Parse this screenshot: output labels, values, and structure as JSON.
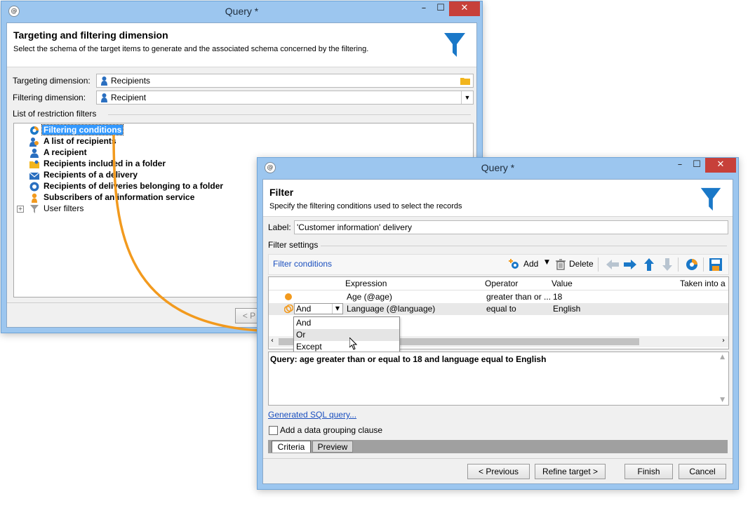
{
  "back_window": {
    "title": "Query *",
    "header_title": "Targeting and filtering dimension",
    "header_subtitle": "Select the schema of the target items to  generate and the associated schema concerned by the filtering.",
    "targeting_label": "Targeting dimension:",
    "targeting_value": "Recipients",
    "filtering_label": "Filtering dimension:",
    "filtering_value": "Recipient",
    "list_label": "List of restriction filters",
    "filters": [
      {
        "label": "Filtering conditions",
        "icon": "filtering-conditions-icon"
      },
      {
        "label": "A list of recipients",
        "icon": "recipient-list-icon"
      },
      {
        "label": "A recipient",
        "icon": "recipient-icon"
      },
      {
        "label": "Recipients included in a folder",
        "icon": "folder-icon"
      },
      {
        "label": "Recipients of a delivery",
        "icon": "envelope-icon"
      },
      {
        "label": "Recipients of deliveries belonging to a folder",
        "icon": "delivery-folder-icon"
      },
      {
        "label": "Subscribers of an information service",
        "icon": "subscriber-icon"
      },
      {
        "label": "User filters",
        "icon": "funnel-icon"
      }
    ],
    "prev_button": "< P"
  },
  "front_window": {
    "title": "Query *",
    "header_title": "Filter",
    "header_subtitle": "Specify the filtering conditions used to select the records",
    "label_label": "Label:",
    "label_value": "'Customer information' delivery",
    "filter_settings": "Filter settings",
    "filter_conditions_link": "Filter conditions",
    "add": "Add",
    "delete": "Delete",
    "columns": {
      "expression": "Expression",
      "operator": "Operator",
      "value": "Value",
      "taken": "Taken into a"
    },
    "rows": [
      {
        "expression": "Age (@age)",
        "operator": "greater than or ...",
        "value": "18"
      },
      {
        "expression": "Language (@language)",
        "operator": "equal to",
        "value": "English"
      }
    ],
    "combo_value": "And",
    "dropdown_options": [
      "And",
      "Or",
      "Except"
    ],
    "query_text": "Query: age greater than or equal to 18 and language equal to English",
    "sql_link": "Generated SQL query...",
    "grouping_label": "Add a data grouping clause",
    "tabs": [
      "Criteria",
      "Preview"
    ],
    "buttons": {
      "previous": "< Previous",
      "refine": "Refine target >",
      "finish": "Finish",
      "cancel": "Cancel"
    }
  },
  "colors": {
    "accent": "#1a78c8",
    "orange": "#f29a1e",
    "selection": "#3399ff"
  }
}
